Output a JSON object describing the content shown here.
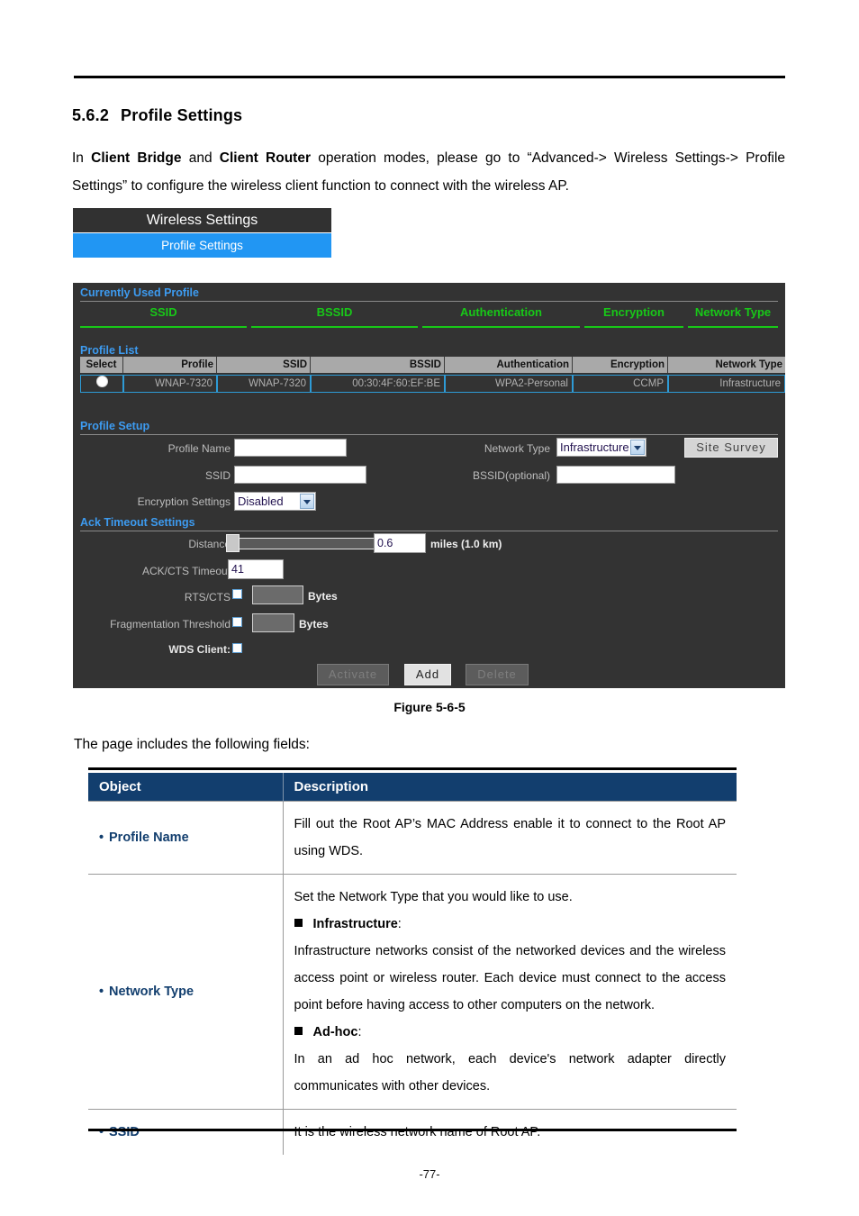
{
  "document": {
    "section_number": "5.6.2",
    "section_title": "Profile Settings",
    "intro_prefix": "In ",
    "intro_bold_1": "Client Bridge",
    "intro_mid_1": " and ",
    "intro_bold_2": "Client Router",
    "intro_rest": " operation modes, please go to “Advanced-> Wireless Settings-> Profile Settings” to configure the wireless client function to connect with the wireless AP.",
    "figure_caption": "Figure 5-6-5",
    "fields_note": "The page includes the following fields:",
    "page_number": "-77-"
  },
  "menu": {
    "parent_label": "Wireless Settings",
    "active_label": "Profile Settings",
    "active_color": "#2196f3",
    "parent_color": "#313131"
  },
  "ui": {
    "currently_used_profile": {
      "title": "Currently Used Profile",
      "columns": [
        "SSID",
        "BSSID",
        "Authentication",
        "Encryption",
        "Network Type"
      ],
      "values": [
        "",
        "",
        "",
        "",
        ""
      ],
      "header_color": "#18c818"
    },
    "profile_list": {
      "title": "Profile List",
      "columns": [
        "Select",
        "Profile",
        "SSID",
        "BSSID",
        "Authentication",
        "Encryption",
        "Network Type"
      ],
      "rows": [
        {
          "selected": true,
          "profile": "WNAP-7320",
          "ssid": "WNAP-7320",
          "bssid": "00:30:4F:60:EF:BE",
          "authentication": "WPA2-Personal",
          "encryption": "CCMP",
          "network_type": "Infrastructure"
        }
      ]
    },
    "profile_setup": {
      "title": "Profile Setup",
      "profile_name_label": "Profile Name",
      "profile_name_value": "",
      "ssid_label": "SSID",
      "ssid_value": "",
      "encryption_settings_label": "Encryption Settings",
      "encryption_settings_value": "Disabled",
      "network_type_label": "Network Type",
      "network_type_value": "Infrastructure",
      "bssid_label": "BSSID(optional)",
      "bssid_value": "",
      "site_survey_label": "Site Survey"
    },
    "ack_timeout": {
      "title": "Ack Timeout Settings",
      "distance_label": "Distance",
      "distance_value": "0.6",
      "distance_unit": "miles (1.0 km)",
      "ack_cts_label": "ACK/CTS Timeout",
      "ack_cts_value": "41",
      "rts_cts_label": "RTS/CTS",
      "rts_cts_value": "",
      "rts_cts_unit": "Bytes",
      "rts_cts_checked": false,
      "frag_label": "Fragmentation Threshold",
      "frag_value": "",
      "frag_unit": "Bytes",
      "frag_checked": false,
      "wds_label": "WDS Client:",
      "wds_checked": false
    },
    "buttons": {
      "activate": "Activate",
      "add": "Add",
      "delete": "Delete"
    }
  },
  "description_table": {
    "headers": [
      "Object",
      "Description"
    ],
    "rows": [
      {
        "object": "Profile Name",
        "lines": [
          {
            "type": "para",
            "text": "Fill out the Root AP’s MAC Address enable it to connect to the Root AP using WDS."
          }
        ]
      },
      {
        "object": "Network Type",
        "lines": [
          {
            "type": "para",
            "text": "Set the Network Type that you would like to use."
          },
          {
            "type": "term",
            "text": "Infrastructure",
            "suffix": ":"
          },
          {
            "type": "para",
            "text": "Infrastructure networks consist of the networked devices and the wireless access point or wireless router. Each device must connect to the access point before having access to other computers on the network."
          },
          {
            "type": "term",
            "text": "Ad-hoc",
            "suffix": ":"
          },
          {
            "type": "para",
            "text": "In an ad hoc network, each device's network adapter directly communicates with other devices."
          }
        ]
      },
      {
        "object": "SSID",
        "lines": [
          {
            "type": "para",
            "text": "It is the wireless network name of Root AP."
          }
        ]
      }
    ]
  }
}
